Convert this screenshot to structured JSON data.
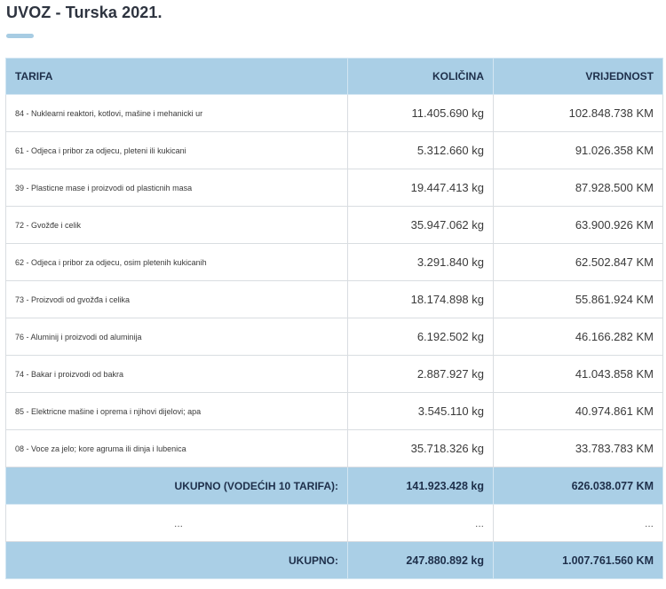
{
  "title": "UVOZ - Turska 2021.",
  "columns": {
    "tarifa": "TARIFA",
    "kolicina": "KOLIČINA",
    "vrijednost": "VRIJEDNOST"
  },
  "rows": [
    {
      "tarifa": "84 - Nuklearni reaktori, kotlovi, mašine i mehanicki ur",
      "kolicina": "11.405.690 kg",
      "vrijednost": "102.848.738 KM"
    },
    {
      "tarifa": "61 - Odjeca i pribor za odjecu, pleteni ili kukicani",
      "kolicina": "5.312.660 kg",
      "vrijednost": "91.026.358 KM"
    },
    {
      "tarifa": "39 - Plasticne mase i proizvodi od plasticnih masa",
      "kolicina": "19.447.413 kg",
      "vrijednost": "87.928.500 KM"
    },
    {
      "tarifa": "72 - Gvožđe i celik",
      "kolicina": "35.947.062 kg",
      "vrijednost": "63.900.926 KM"
    },
    {
      "tarifa": "62 - Odjeca i pribor za odjecu, osim pletenih kukicanih",
      "kolicina": "3.291.840 kg",
      "vrijednost": "62.502.847 KM"
    },
    {
      "tarifa": "73 - Proizvodi od gvožđa i celika",
      "kolicina": "18.174.898 kg",
      "vrijednost": "55.861.924 KM"
    },
    {
      "tarifa": "76 - Aluminij i proizvodi od aluminija",
      "kolicina": "6.192.502 kg",
      "vrijednost": "46.166.282 KM"
    },
    {
      "tarifa": "74 - Bakar i proizvodi od bakra",
      "kolicina": "2.887.927 kg",
      "vrijednost": "41.043.858 KM"
    },
    {
      "tarifa": "85 - Elektricne mašine i oprema i njihovi dijelovi; apa",
      "kolicina": "3.545.110 kg",
      "vrijednost": "40.974.861 KM"
    },
    {
      "tarifa": "08 - Voce za jelo; kore agruma ili dinja i lubenica",
      "kolicina": "35.718.326 kg",
      "vrijednost": "33.783.783 KM"
    }
  ],
  "subtotal": {
    "label": "UKUPNO (VODEĆIH 10 TARIFA):",
    "kolicina": "141.923.428 kg",
    "vrijednost": "626.038.077 KM"
  },
  "ellipsis": {
    "tarifa": "...",
    "kolicina": "...",
    "vrijednost": "..."
  },
  "total": {
    "label": "UKUPNO:",
    "kolicina": "247.880.892 kg",
    "vrijednost": "1.007.761.560 KM"
  }
}
